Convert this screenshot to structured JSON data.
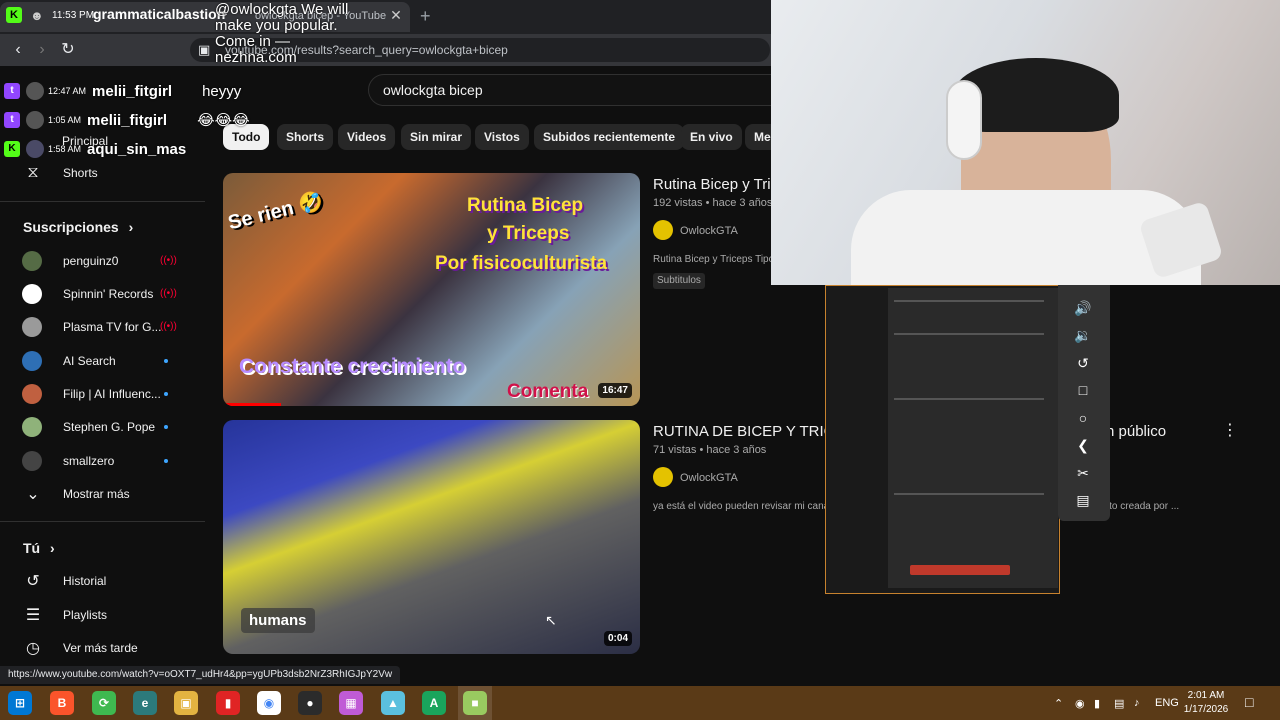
{
  "browser": {
    "tab_title": "owlockgta bicep - YouTube",
    "url": "youtube.com/results?search_query=owlockgta+bicep",
    "status_url": "https://www.youtube.com/watch?v=oOXT7_udHr4&pp=ygUPb3dsb2NrZ3RhIGJpY2Vw",
    "overlay_time": "11:53 PM",
    "overlay_channel": "grammaticalbastion"
  },
  "youtube": {
    "search_query": "owlockgta bicep",
    "chips": [
      "Todo",
      "Shorts",
      "Videos",
      "Sin mirar",
      "Vistos",
      "Subidos recientemente",
      "En vivo",
      "Me"
    ],
    "sidebar": {
      "principal": "Principal",
      "shorts": "Shorts",
      "subs_header": "Suscripciones",
      "subs": [
        {
          "name": "penguinz0",
          "status": "live"
        },
        {
          "name": "Spinnin' Records",
          "status": "live"
        },
        {
          "name": "Plasma TV for G...",
          "status": "live"
        },
        {
          "name": "AI Search",
          "status": "new"
        },
        {
          "name": "Filip | AI Influenc...",
          "status": "new"
        },
        {
          "name": "Stephen G. Pope",
          "status": "new"
        },
        {
          "name": "smallzero",
          "status": "new"
        }
      ],
      "show_more": "Mostrar más",
      "you_header": "Tú",
      "you_items": [
        "Historial",
        "Playlists",
        "Ver más tarde"
      ]
    },
    "videos": [
      {
        "title": "Rutina Bicep y Tric",
        "meta": "192 vistas • hace 3 años",
        "channel": "OwlockGTA",
        "desc": "Rutina Bicep y Triceps Tipo",
        "badge": "Subtitulos",
        "duration": "16:47",
        "overlay_1": "Se rien 🤣",
        "overlay_2": "Rutina Bicep",
        "overlay_3": "y Triceps",
        "overlay_4": "Por fisicoculturista",
        "overlay_5": "Constante crecimiento",
        "overlay_6": "Comenta"
      },
      {
        "title": "RUTINA DE BICEP Y TRICE",
        "title_tail": "n público",
        "meta": "71 vistas • hace 3 años",
        "channel": "OwlockGTA",
        "desc": "ya está el video pueden revisar mi cana",
        "desc_tail": "ento creada por ...",
        "duration": "0:04",
        "overlay_1": "humans"
      }
    ]
  },
  "chat": [
    {
      "time": "12:47 AM",
      "user": "melii_fitgirl",
      "msg": "heyyy",
      "platform": "twitch"
    },
    {
      "time": "1:05 AM",
      "user": "melii_fitgirl",
      "msg": "😂😂😂",
      "platform": "twitch"
    },
    {
      "time": "1:58 AM",
      "user": "aqui_sin_mas",
      "msg": "",
      "platform": "kick"
    }
  ],
  "watermark": "@owlockgta We will make you popular. Come in —nezhna.com",
  "taskbar": {
    "time": "2:01 AM",
    "date": "1/17/2026",
    "lang": "ENG"
  },
  "colors": {
    "yt_bg": "#0f0f0f",
    "accent_red": "#ff0000",
    "live_red": "#ff0033",
    "new_dot": "#3ea6ff",
    "taskbar": "#5a3a17"
  }
}
